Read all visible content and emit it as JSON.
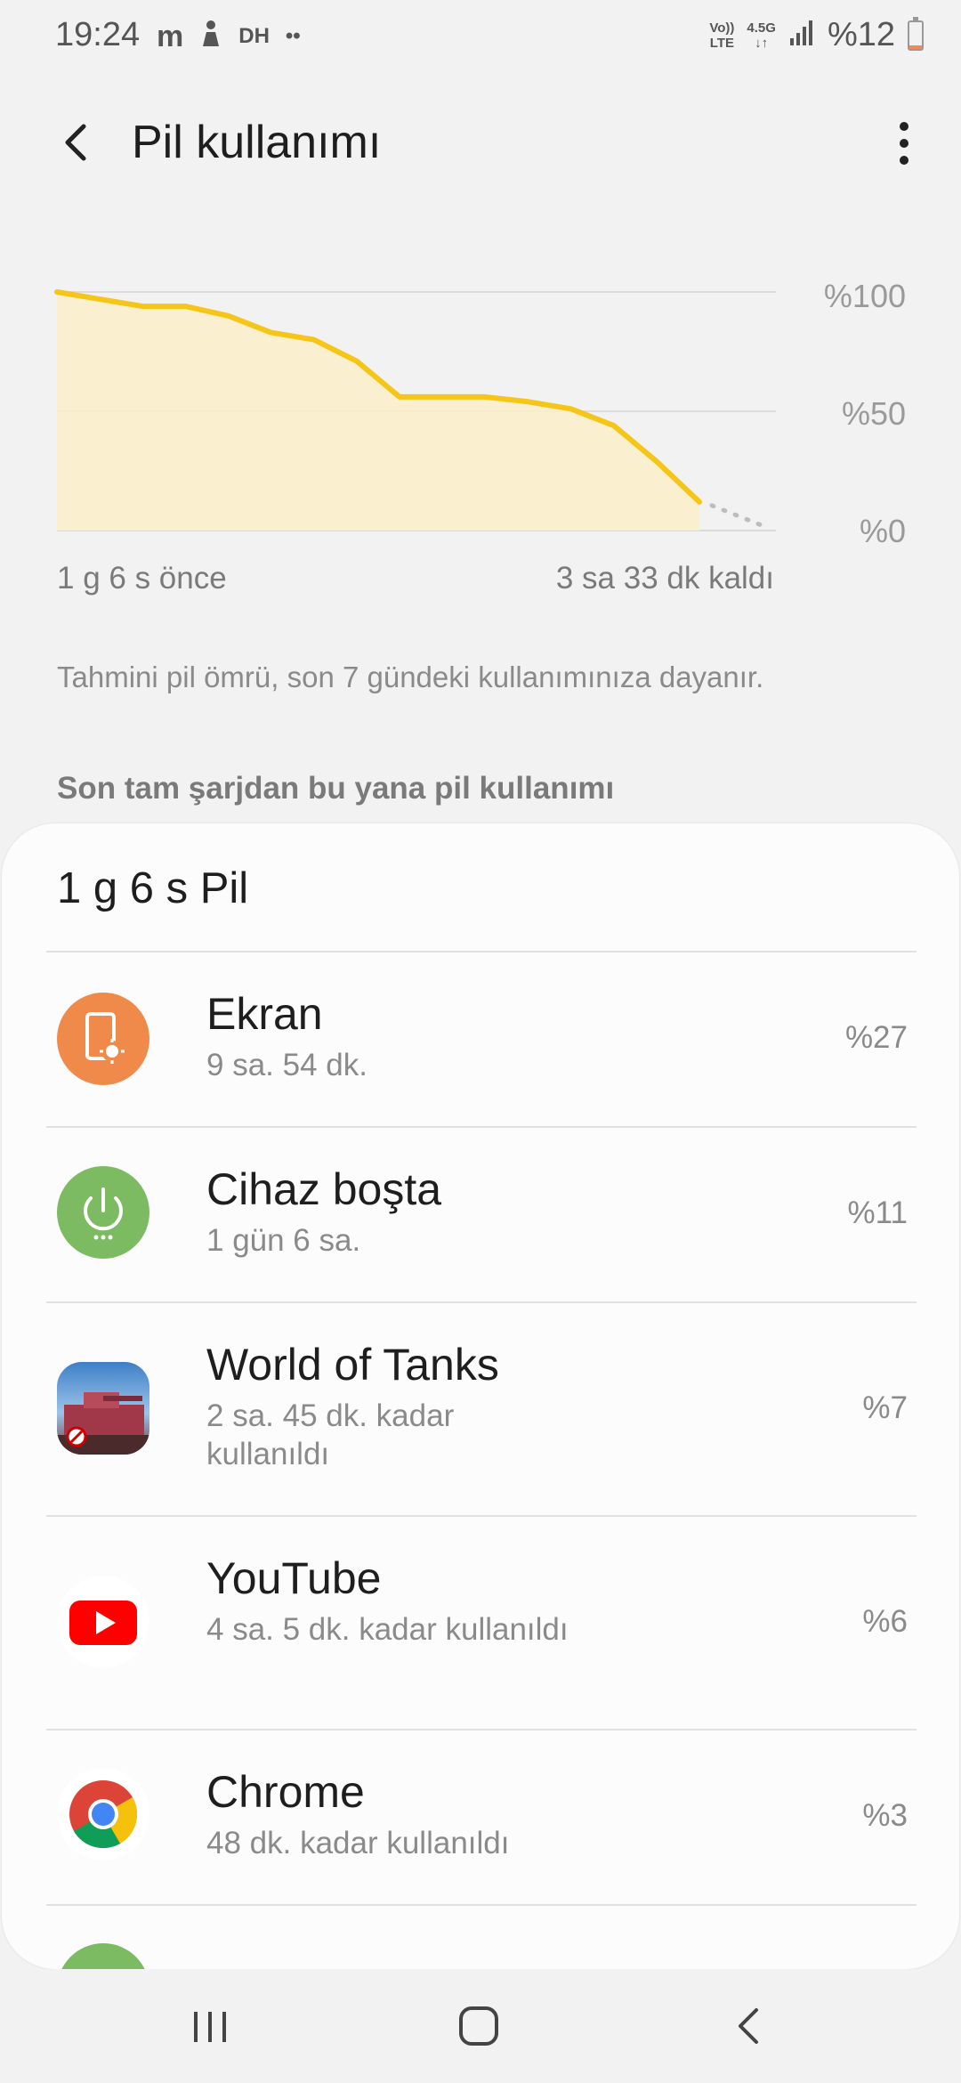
{
  "status_bar": {
    "time": "19:24",
    "notif_icons": [
      "m",
      "DH",
      "••"
    ],
    "network_top": "Vo))",
    "network_bottom": "LTE",
    "data_top": "4.5G",
    "data_bottom": "↓↑",
    "battery_text": "%12",
    "battery_level": 0.12
  },
  "header": {
    "title": "Pil kullanımı"
  },
  "chart_data": {
    "type": "area",
    "y_ticks": [
      "%100",
      "%50",
      "%0"
    ],
    "ylim": [
      0,
      100
    ],
    "x_start_label": "1 g 6 s önce",
    "x_end_label": "3 sa 33 dk kaldı",
    "series": [
      {
        "values": [
          100,
          97,
          94,
          94,
          90,
          83,
          80,
          71,
          56,
          56,
          56,
          54,
          51,
          44,
          29,
          12
        ],
        "line_color": "#f5c518",
        "fill_color": "#fbf0c9"
      }
    ],
    "projection": [
      12,
      1
    ]
  },
  "info_text": "Tahmini pil ömrü, son 7 gündeki kullanımınıza dayanır.",
  "section_title": "Son tam şarjdan bu yana pil kullanımı",
  "card": {
    "title": "1 g 6 s Pil",
    "items": [
      {
        "name": "Ekran",
        "sub": "9 sa. 54 dk.",
        "pct": "%27",
        "icon": "screen-brightness-icon",
        "color": "#f08a4b"
      },
      {
        "name": "Cihaz boşta",
        "sub": "1 gün 6 sa.",
        "pct": "%11",
        "icon": "power-idle-icon",
        "color": "#7dbb63"
      },
      {
        "name": "World of Tanks",
        "sub": "2 sa. 45 dk. kadar kullanıldı",
        "pct": "%7",
        "icon": "world-of-tanks-icon"
      },
      {
        "name": "YouTube",
        "sub": "4 sa. 5 dk. kadar kullanıldı",
        "pct": "%6",
        "icon": "youtube-icon",
        "color": "#ff0000"
      },
      {
        "name": "Chrome",
        "sub": "48 dk. kadar kullanıldı",
        "pct": "%3",
        "icon": "chrome-icon"
      }
    ]
  }
}
